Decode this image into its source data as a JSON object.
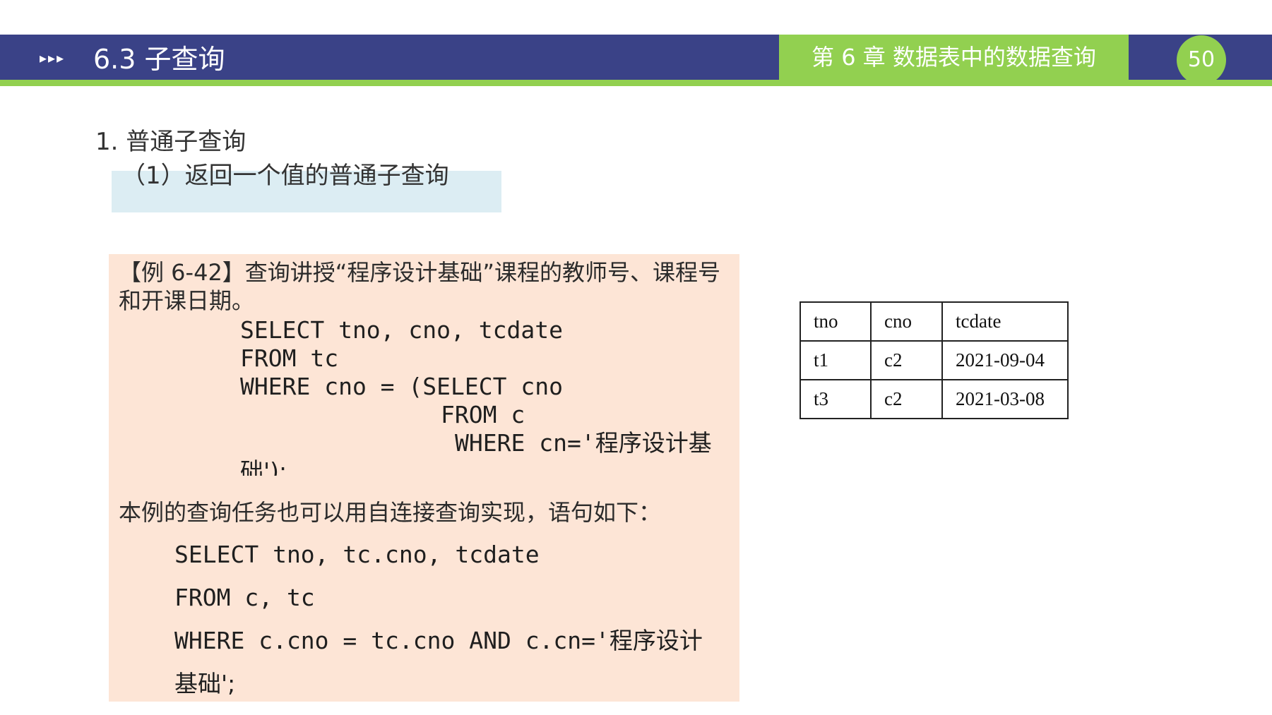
{
  "header": {
    "arrows": "▸▸▸",
    "section_title": "6.3  子查询",
    "chapter": "第 6 章  数据表中的数据查询",
    "page_number": "50",
    "colors": {
      "bar": "#3a4287",
      "accent": "#92d050"
    }
  },
  "content": {
    "heading": "1.  普通子查询",
    "subheading": "（1）返回一个值的普通子查询",
    "example": {
      "title": "【例 6-42】查询讲授“程序设计基础”课程的教师号、课程号和开课日期。",
      "code": [
        "SELECT tno, cno, tcdate",
        "FROM tc",
        "WHERE cno = (SELECT cno",
        "FROM c",
        "WHERE cn='",
        "程序设计基",
        "础');"
      ],
      "explanation": "本例的查询任务也可以用自连接查询实现，语句如下：",
      "join_code": [
        "SELECT tno, tc.cno, tcdate",
        "FROM c, tc",
        "WHERE c.cno = tc.cno AND c.cn='",
        "程序设计",
        "基础';"
      ]
    }
  },
  "table": {
    "headers": [
      "tno",
      "cno",
      "tcdate"
    ],
    "rows": [
      [
        "t1",
        "c2",
        "2021-09-04"
      ],
      [
        "t3",
        "c2",
        "2021-03-08"
      ]
    ]
  }
}
